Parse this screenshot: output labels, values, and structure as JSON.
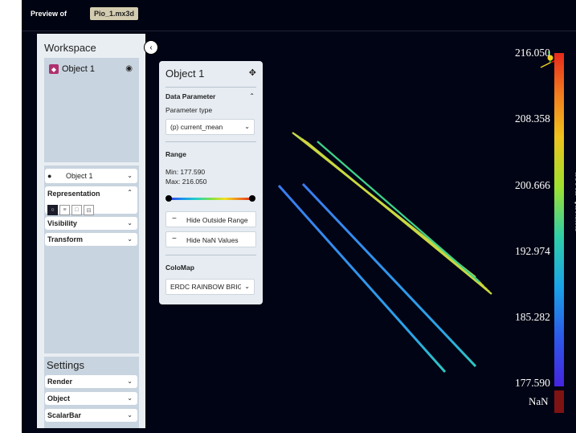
{
  "topbar": {
    "preview_label": "Preview of",
    "file_name": "Pio_1.mx3d"
  },
  "workspace": {
    "title": "Workspace",
    "object_name": "Object 1",
    "selected_object": "Object 1",
    "representation_label": "Representation",
    "visibility_label": "Visibility",
    "transform_label": "Transform",
    "settings_title": "Settings",
    "settings_items": [
      "Render",
      "Object",
      "ScalarBar"
    ]
  },
  "object_panel": {
    "title": "Object 1",
    "data_parameter_label": "Data Parameter",
    "parameter_type_label": "Parameter type",
    "parameter_value": "(p) current_mean",
    "range_label": "Range",
    "min_text": "Min: 177.590",
    "max_text": "Max: 216.050",
    "hide_outside_label": "Hide Outside Range",
    "hide_nan_label": "Hide NaN Values",
    "colormap_label": "ColoMap",
    "colormap_value": "ERDC RAINBOW BRIGHT"
  },
  "scalar_bar": {
    "title": "current_mean",
    "ticks": [
      "216.050",
      "208.358",
      "200.666",
      "192.974",
      "185.282",
      "177.590"
    ],
    "nan_label": "NaN",
    "nan_color": "#7f1212"
  },
  "colors": {
    "background": "#000414",
    "panel": "#e6ecf2",
    "accent": "#1b1b2a"
  }
}
